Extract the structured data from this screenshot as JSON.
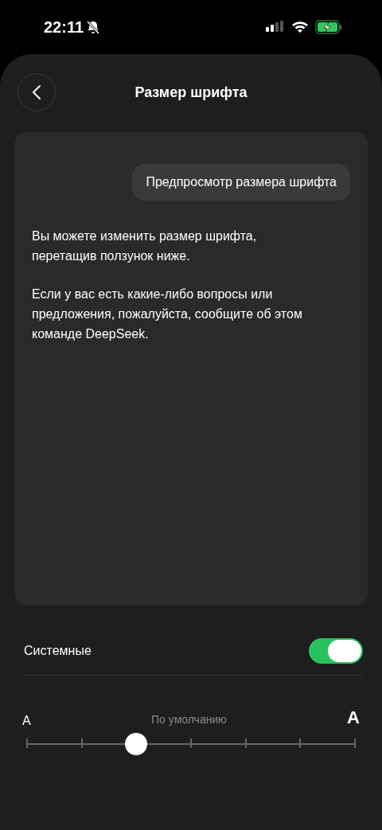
{
  "status_bar": {
    "time": "22:11",
    "silent": true,
    "charging": true
  },
  "header": {
    "title": "Размер шрифта"
  },
  "preview": {
    "bubble": "Предпросмотр размера шрифта",
    "paragraphs": [
      "Вы можете изменить размер шрифта, перетащив ползунок ниже.",
      "Если у вас есть какие-либо вопросы или предложения, пожалуйста, сообщите об этом команде DeepSeek."
    ]
  },
  "system_toggle": {
    "label": "Системные",
    "on": true
  },
  "font_slider": {
    "small_label": "A",
    "default_label": "По умолчанию",
    "large_label": "A",
    "level": 0.3333
  }
}
